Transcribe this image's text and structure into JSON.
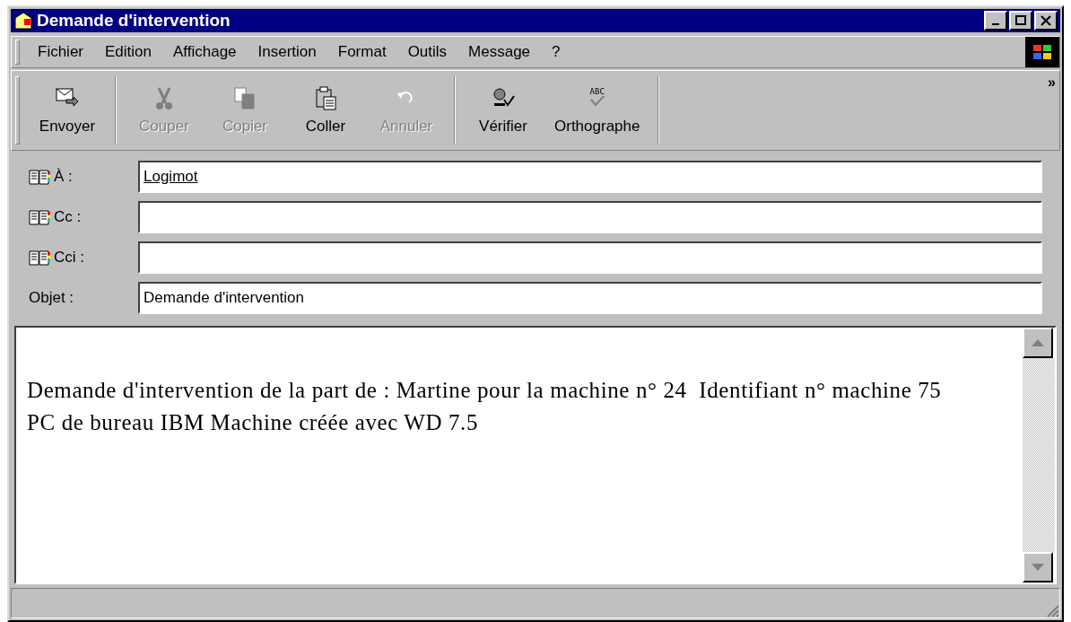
{
  "window": {
    "title": "Demande d'intervention"
  },
  "menu": [
    {
      "label": "Fichier"
    },
    {
      "label": "Edition"
    },
    {
      "label": "Affichage"
    },
    {
      "label": "Insertion"
    },
    {
      "label": "Format"
    },
    {
      "label": "Outils"
    },
    {
      "label": "Message"
    },
    {
      "label": "?"
    }
  ],
  "toolbar": [
    {
      "label": "Envoyer",
      "kind": "send",
      "disabled": false,
      "separator_after": true
    },
    {
      "label": "Couper",
      "kind": "cut",
      "disabled": true,
      "separator_after": false
    },
    {
      "label": "Copier",
      "kind": "copy",
      "disabled": true,
      "separator_after": false
    },
    {
      "label": "Coller",
      "kind": "paste",
      "disabled": false,
      "separator_after": false
    },
    {
      "label": "Annuler",
      "kind": "undo",
      "disabled": true,
      "separator_after": true
    },
    {
      "label": "Vérifier",
      "kind": "check",
      "disabled": false,
      "separator_after": false
    },
    {
      "label": "Orthographe",
      "kind": "spell",
      "icon_text": "ABC",
      "disabled": false,
      "separator_after": true
    }
  ],
  "toolbar_more": "»",
  "fields": [
    {
      "label": "À :",
      "address_book": true,
      "value": "Logimot",
      "resolved": true
    },
    {
      "label": "Cc :",
      "address_book": true
    },
    {
      "label": "Cci :",
      "address_book": true
    },
    {
      "label": "Objet :",
      "address_book": false,
      "value": "Demande d'intervention",
      "resolved": false
    }
  ],
  "body": "Demande d'intervention de la part de : Martine pour la machine n° 24  Identifiant n° machine 75 PC de bureau IBM Machine créée avec WD 7.5"
}
